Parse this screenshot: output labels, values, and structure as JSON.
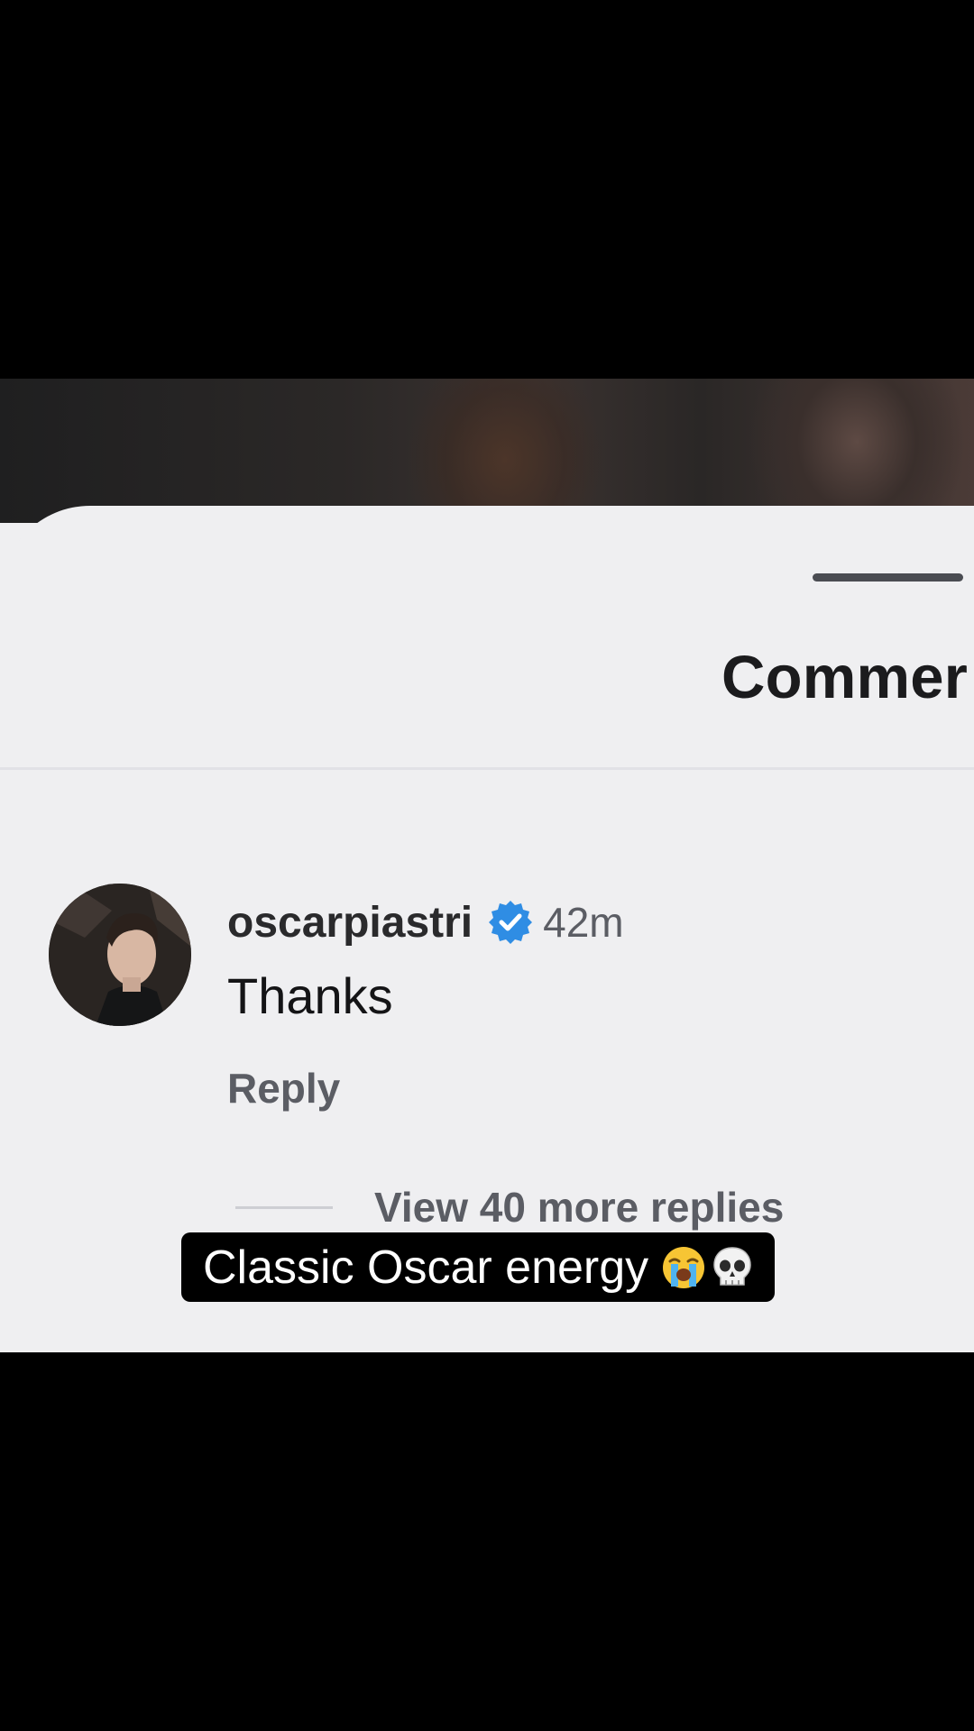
{
  "sheet": {
    "title": "Commer"
  },
  "comment": {
    "username": "oscarpiastri",
    "verified": true,
    "time": "42m",
    "text": "Thanks",
    "reply_label": "Reply",
    "view_replies_label": "View 40 more replies"
  },
  "caption": {
    "text": "Classic Oscar energy",
    "emojis": [
      "loudly-crying-face",
      "skull"
    ]
  },
  "icons": {
    "verified_badge": "verified-badge-icon",
    "grabber": "drag-handle"
  },
  "colors": {
    "sheet_bg": "#efeff1",
    "verified_blue": "#2f8de4",
    "primary_text": "#141416",
    "secondary_text": "#5b5d64",
    "caption_bg": "#000000",
    "caption_text": "#ffffff"
  }
}
